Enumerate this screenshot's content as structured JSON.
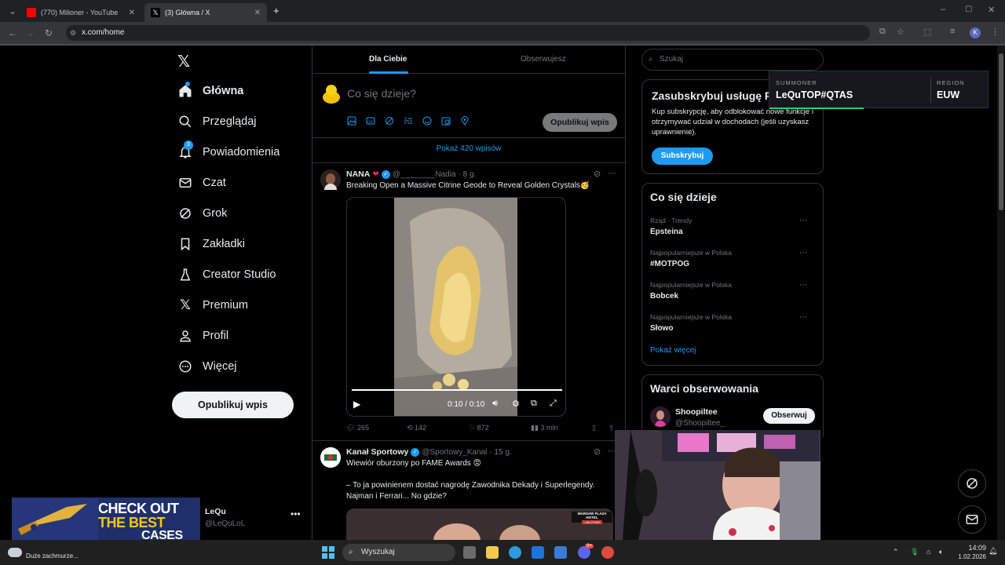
{
  "browser": {
    "tabs": [
      {
        "title": "(770) Milioner - YouTube",
        "active": false
      },
      {
        "title": "(3) Główna / X",
        "active": true
      }
    ],
    "url": "x.com/home"
  },
  "sidebar": {
    "items": [
      {
        "label": "Główna",
        "icon": "home-icon"
      },
      {
        "label": "Przeglądaj",
        "icon": "search-icon"
      },
      {
        "label": "Powiadomienia",
        "icon": "bell-icon",
        "badge": "3"
      },
      {
        "label": "Czat",
        "icon": "mail-icon"
      },
      {
        "label": "Grok",
        "icon": "grok-icon"
      },
      {
        "label": "Zakładki",
        "icon": "bookmark-icon"
      },
      {
        "label": "Creator Studio",
        "icon": "flask-icon"
      },
      {
        "label": "Premium",
        "icon": "x-logo-icon"
      },
      {
        "label": "Profil",
        "icon": "person-icon"
      },
      {
        "label": "Więcej",
        "icon": "more-circle-icon"
      }
    ],
    "post_button": "Opublikuj wpis",
    "account": {
      "name": "LeQu",
      "handle": "@LeQuLoL"
    }
  },
  "promo": {
    "line1": "CHECK OUT",
    "line2": "THE BEST",
    "line3": "CASES"
  },
  "feed": {
    "tabs": [
      "Dla Ciebie",
      "Obserwujesz"
    ],
    "compose_placeholder": "Co się dzieje?",
    "compose_button": "Opublikuj wpis",
    "show_more": "Pokaż 420 wpisów",
    "posts": [
      {
        "name": "NANA",
        "handle": "@________Nadia",
        "time": "· 8 g.",
        "text": "Breaking Open a Massive Citrine Geode to Reveal Golden Crystals🥳",
        "video_time": "0:10 / 0:10",
        "video_progress": 1.0,
        "replies": "265",
        "reposts": "142",
        "likes": "872",
        "views": "3 mln"
      },
      {
        "name": "Kanał Sportowy",
        "handle": "@Sportowy_Kanal",
        "time": "· 15 g.",
        "text1": "Wiewiór oburzony po FAME Awards 😡",
        "text2": "– To ja powinienem dostać nagrodę Zawodnika Dekady i Superlegendy. Najman i Ferrari... No gdzie?",
        "image_badge": "WARSAW PLAZA HOTEL",
        "image_badge_sub": "• NA ŻYWO"
      }
    ]
  },
  "right": {
    "search_placeholder": "Szukaj",
    "subscribe": {
      "title": "Zasubskrybuj usługę Premium",
      "body": "Kup subskrypcję, aby odblokować nowe funkcje i otrzymywać udział w dochodach (jeśli uzyskasz uprawnienie).",
      "button": "Subskrybuj"
    },
    "trends": {
      "title": "Co się dzieje",
      "items": [
        {
          "category": "Rząd · Trendy",
          "name": "Epsteina"
        },
        {
          "category": "Najpopularniejsze w Polska",
          "name": "#MOTPOG"
        },
        {
          "category": "Najpopularniejsze w Polska",
          "name": "Bobcek"
        },
        {
          "category": "Najpopularniejsze w Polska",
          "name": "Słowo"
        }
      ],
      "show_more": "Pokaż więcej"
    },
    "follow": {
      "title": "Warci obserwowania",
      "name": "Shoopiltee",
      "handle": "@Shoopiltee_",
      "button": "Obserwuj"
    }
  },
  "overlay": {
    "summoner_label": "SUMMONER",
    "summoner_value": "LeQuTOP#QTAS",
    "region_label": "REGION",
    "region_value": "EUW"
  },
  "taskbar": {
    "weather": "Duże zachmurze...",
    "search": "Wyszukaj",
    "time": "14:09",
    "date": "1.02.2026",
    "discord_badge": "9+"
  }
}
